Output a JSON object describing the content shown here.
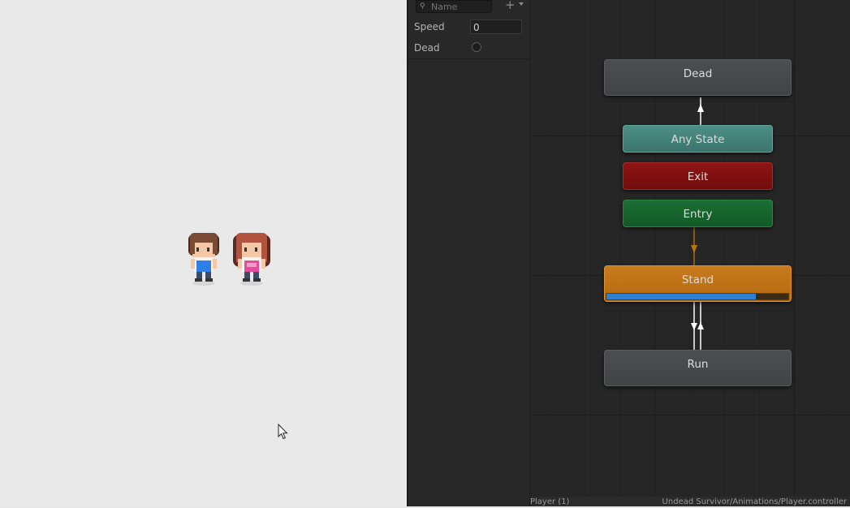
{
  "parameters": {
    "search_placeholder": "Name",
    "add_icon": "plus-icon",
    "items": [
      {
        "name": "Speed",
        "type": "float",
        "value": "0"
      },
      {
        "name": "Dead",
        "type": "bool",
        "value": false
      }
    ]
  },
  "graph": {
    "states": {
      "dead": "Dead",
      "any_state": "Any State",
      "exit": "Exit",
      "entry": "Entry",
      "stand": "Stand",
      "run": "Run"
    },
    "stand_progress": 0.82
  },
  "statusbar": {
    "left": "Player (1)",
    "right": "Undead Survivor/Animations/Player.controller"
  },
  "colors": {
    "stand_node": "#c87b1d",
    "any_state_node": "#4e8f86",
    "exit_node": "#8e1414",
    "entry_node": "#1b6f34",
    "progress": "#2f7fd2"
  }
}
